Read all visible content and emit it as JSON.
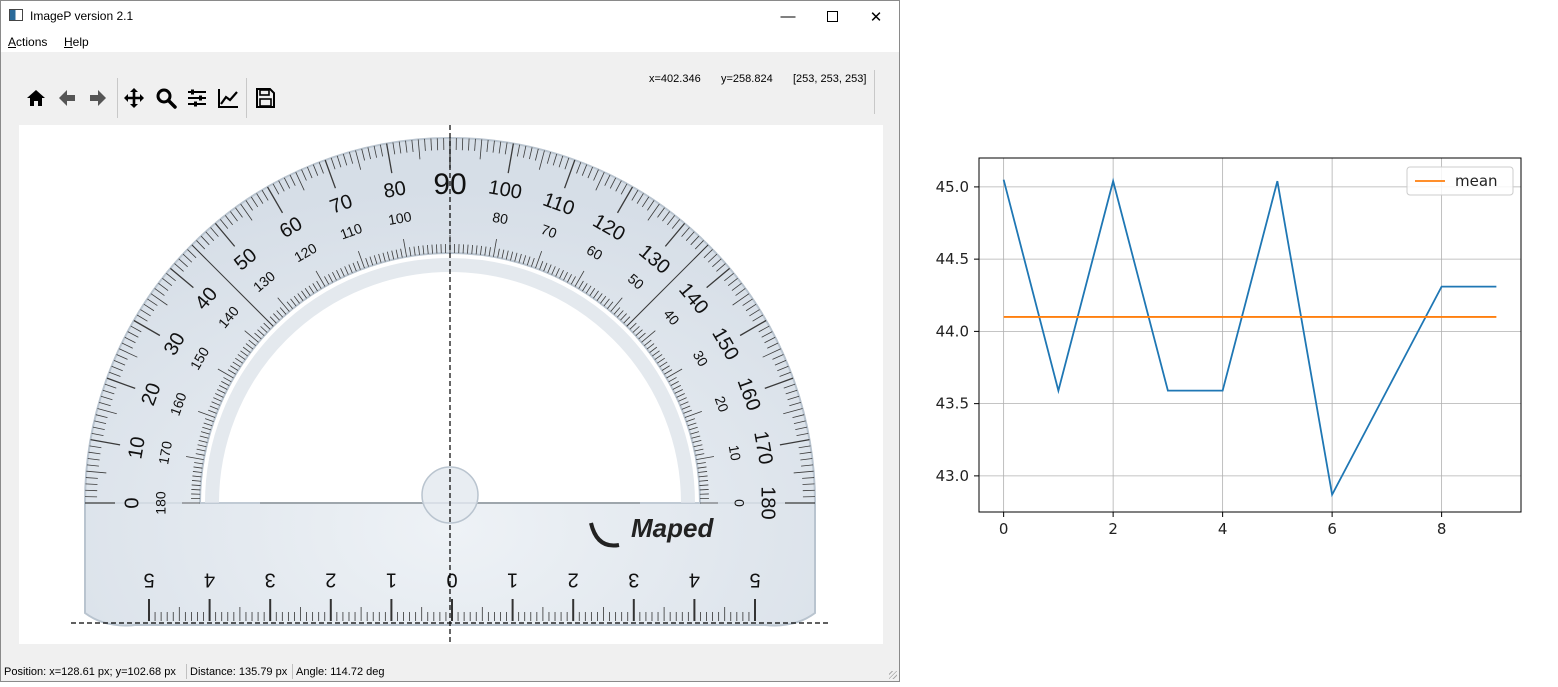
{
  "window": {
    "title": "ImageP version 2.1",
    "minimize_glyph": "—",
    "close_glyph": "✕"
  },
  "menu": {
    "actions": {
      "mnemonic": "A",
      "rest": "ctions"
    },
    "help": {
      "mnemonic": "H",
      "rest": "elp"
    }
  },
  "toolbar": {
    "buttons": [
      "home-icon",
      "back-arrow-icon",
      "forward-arrow-icon",
      "pan-icon",
      "zoom-icon",
      "configure-subplots-icon",
      "edit-axis-icon",
      "save-icon"
    ],
    "coord_x": "x=402.346",
    "coord_y": "y=258.824",
    "pixel_value": "[253, 253, 253]"
  },
  "image": {
    "brand": "Maped",
    "outer_scale_labels": [
      "0",
      "10",
      "20",
      "30",
      "40",
      "50",
      "60",
      "70",
      "80",
      "90",
      "100",
      "110",
      "120",
      "130",
      "140",
      "150",
      "160",
      "170",
      "180"
    ],
    "inner_scale_labels": [
      "180",
      "170",
      "160",
      "150",
      "140",
      "130",
      "120",
      "110",
      "100",
      "80",
      "70",
      "60",
      "50",
      "40",
      "30",
      "20",
      "10",
      "0"
    ],
    "ruler_labels": [
      "5",
      "4",
      "3",
      "2",
      "1",
      "0",
      "1",
      "2",
      "3",
      "4",
      "5"
    ]
  },
  "status": {
    "position": "Position: x=128.61 px; y=102.68 px",
    "distance": "Distance: 135.79 px",
    "angle": "Angle: 114.72 deg"
  },
  "colors": {
    "series_line": "#1f77b4",
    "mean_line": "#ff7f0e",
    "protractor_body": "#dfe6ed",
    "protractor_edge": "#b9c4cf"
  },
  "chart_data": {
    "type": "line",
    "title": "",
    "xlabel": "",
    "ylabel": "",
    "xlim": [
      -0.45,
      9.45
    ],
    "ylim": [
      42.75,
      45.2
    ],
    "xticks": [
      "0",
      "2",
      "4",
      "6",
      "8"
    ],
    "yticks": [
      "43.0",
      "43.5",
      "44.0",
      "44.5",
      "45.0"
    ],
    "grid": true,
    "legend": "top-right",
    "series": [
      {
        "name": "",
        "x": [
          0,
          1,
          2,
          3,
          4,
          5,
          6,
          7,
          8,
          9
        ],
        "y": [
          45.05,
          43.59,
          45.04,
          43.59,
          43.59,
          45.04,
          42.87,
          43.59,
          44.31,
          44.31
        ]
      },
      {
        "name": "mean",
        "x": [
          0,
          9
        ],
        "y": [
          44.1,
          44.1
        ]
      }
    ]
  }
}
